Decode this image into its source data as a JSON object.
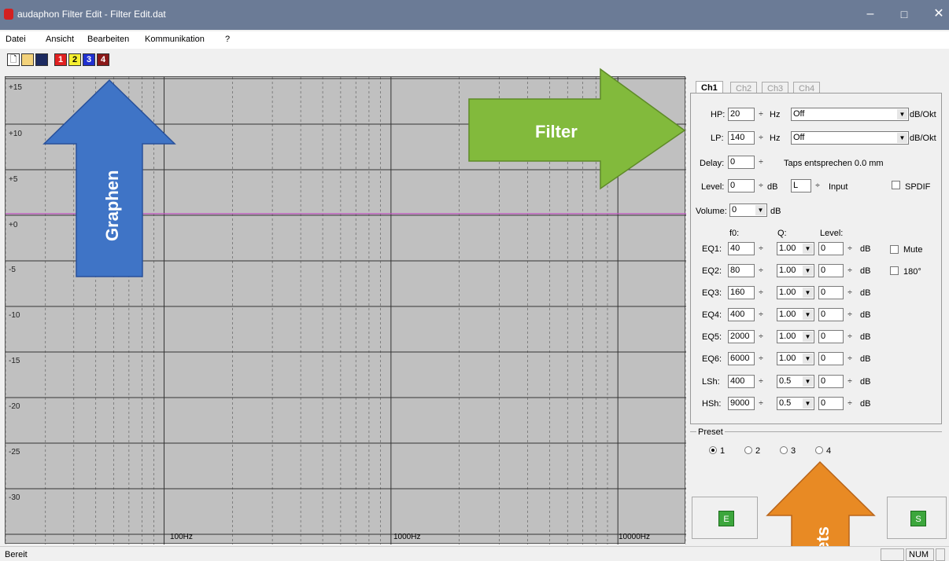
{
  "window": {
    "title": "audaphon Filter Edit - Filter Edit.dat",
    "minimize": "–",
    "maximize": "□",
    "close": "✕"
  },
  "menu": [
    "Datei",
    "Ansicht",
    "Bearbeiten",
    "Kommunikation",
    "?"
  ],
  "toolbar": {
    "new": "new-file-icon",
    "open": "open-folder-icon",
    "save": "save-disk-icon",
    "graphs": [
      "1",
      "2",
      "3",
      "4"
    ]
  },
  "graph": {
    "y_labels": [
      "+15",
      "+10",
      "+5",
      "+0",
      "-5",
      "-10",
      "-15",
      "-20",
      "-25",
      "-30"
    ],
    "x_labels": [
      "100Hz",
      "1000Hz",
      "10000Hz"
    ],
    "curve_color": "#c050c0"
  },
  "tabs": [
    "Ch1",
    "Ch2",
    "Ch3",
    "Ch4"
  ],
  "hp": {
    "label": "HP:",
    "value": "20",
    "unit": "Hz",
    "type": "Off",
    "slope_unit": "dB/Okt"
  },
  "lp": {
    "label": "LP:",
    "value": "140",
    "unit": "Hz",
    "type": "Off",
    "slope_unit": "dB/Okt"
  },
  "delay": {
    "label": "Delay:",
    "value": "0",
    "info": "Taps entsprechen 0.0 mm"
  },
  "level": {
    "label": "Level:",
    "value": "0",
    "unit": "dB",
    "input_value": "L",
    "input_label": "Input",
    "spdif": "SPDIF"
  },
  "volume": {
    "label": "Volume:",
    "value": "0",
    "unit": "dB"
  },
  "eq_headers": {
    "f0": "f0:",
    "q": "Q:",
    "level": "Level:"
  },
  "eq_rows": [
    {
      "label": "EQ1:",
      "f0": "40",
      "q": "1.00",
      "level": "0",
      "unit": "dB"
    },
    {
      "label": "EQ2:",
      "f0": "80",
      "q": "1.00",
      "level": "0",
      "unit": "dB"
    },
    {
      "label": "EQ3:",
      "f0": "160",
      "q": "1.00",
      "level": "0",
      "unit": "dB"
    },
    {
      "label": "EQ4:",
      "f0": "400",
      "q": "1.00",
      "level": "0",
      "unit": "dB"
    },
    {
      "label": "EQ5:",
      "f0": "2000",
      "q": "1.00",
      "level": "0",
      "unit": "dB"
    },
    {
      "label": "EQ6:",
      "f0": "6000",
      "q": "1.00",
      "level": "0",
      "unit": "dB"
    },
    {
      "label": "LSh:",
      "f0": "400",
      "q": "0.5",
      "level": "0",
      "unit": "dB"
    },
    {
      "label": "HSh:",
      "f0": "9000",
      "q": "0.5",
      "level": "0",
      "unit": "dB"
    }
  ],
  "mute": "Mute",
  "phase": "180°",
  "preset": {
    "label": "Preset",
    "options": [
      "1",
      "2",
      "3",
      "4"
    ],
    "selected": "1"
  },
  "buttons": {
    "e": "E",
    "s": "S"
  },
  "annotations": {
    "graphen": "Graphen",
    "filter": "Filter",
    "presets": "sets"
  },
  "status": {
    "text": "Bereit",
    "num": "NUM"
  }
}
